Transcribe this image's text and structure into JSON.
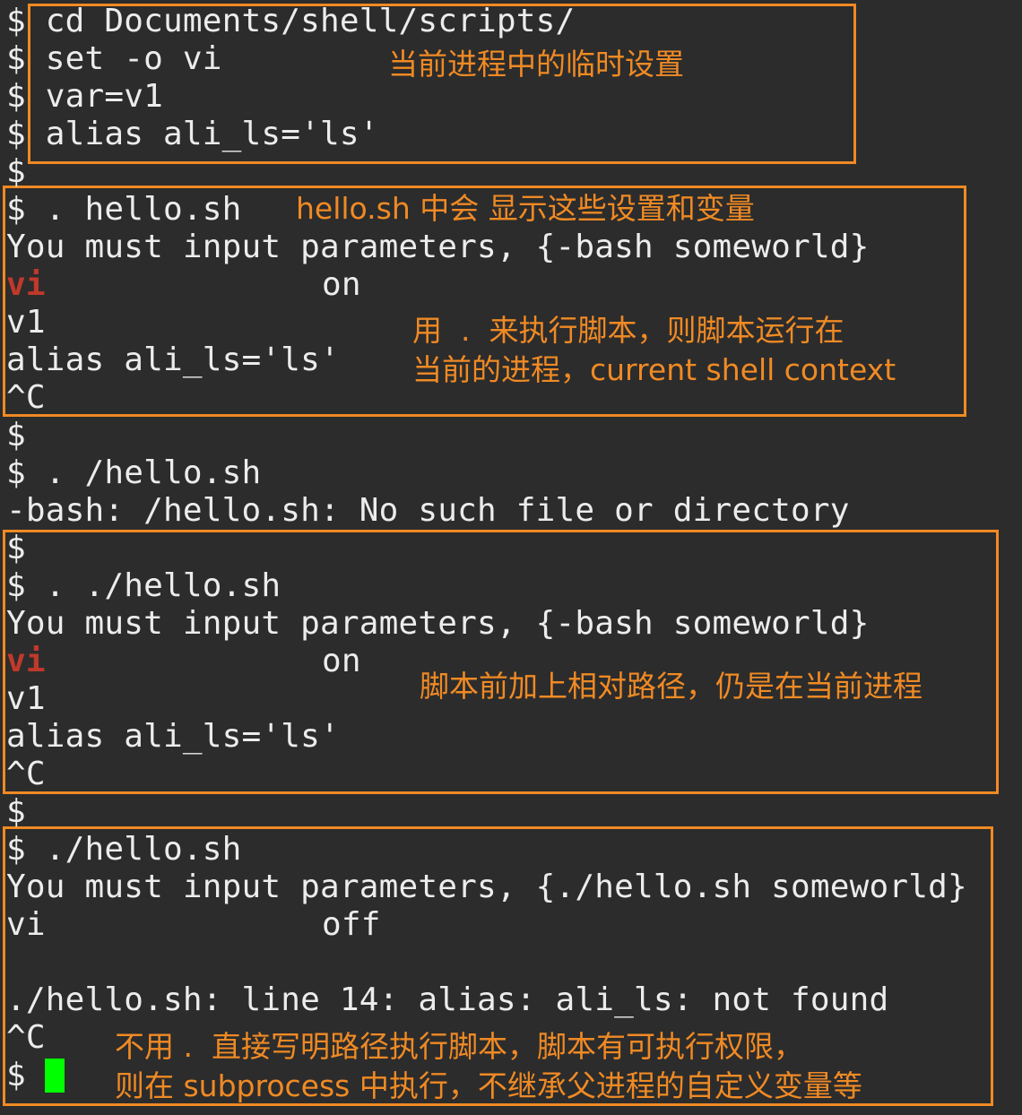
{
  "terminal": {
    "lines": [
      "$ cd Documents/shell/scripts/",
      "$ set -o vi",
      "$ var=v1",
      "$ alias ali_ls='ls'",
      "$",
      "$ . hello.sh",
      "You must input parameters, {-bash someworld}",
      "vi",
      "on",
      "v1",
      "alias ali_ls='ls'",
      "^C",
      "$",
      "$ . /hello.sh",
      "-bash: /hello.sh: No such file or directory",
      "$",
      "$ . ./hello.sh",
      "You must input parameters, {-bash someworld}",
      "vi",
      "on",
      "v1",
      "alias ali_ls='ls'",
      "^C",
      "$",
      "$ ./hello.sh",
      "You must input parameters, {./hello.sh someworld}",
      "vi",
      "off",
      "./hello.sh: line 14: alias: ali_ls: not found",
      "^C",
      "$"
    ]
  },
  "annotations": {
    "note1": "当前进程中的临时设置",
    "note2": "hello.sh 中会 显示这些设置和变量",
    "note3": "用  .  来执行脚本，则脚本运行在",
    "note4": "当前的进程，current shell context",
    "note5": "脚本前加上相对路径，仍是在当前进程",
    "note6": "不用 .  直接写明路径执行脚本，脚本有可执行权限，",
    "note7": "则在 subprocess 中执行，不继承父进程的自定义变量等"
  },
  "colors": {
    "background": "#2c2c2c",
    "text": "#ececec",
    "highlight_red": "#c0392b",
    "annotation_orange": "#f08a24",
    "cursor_green": "#00ff00"
  }
}
